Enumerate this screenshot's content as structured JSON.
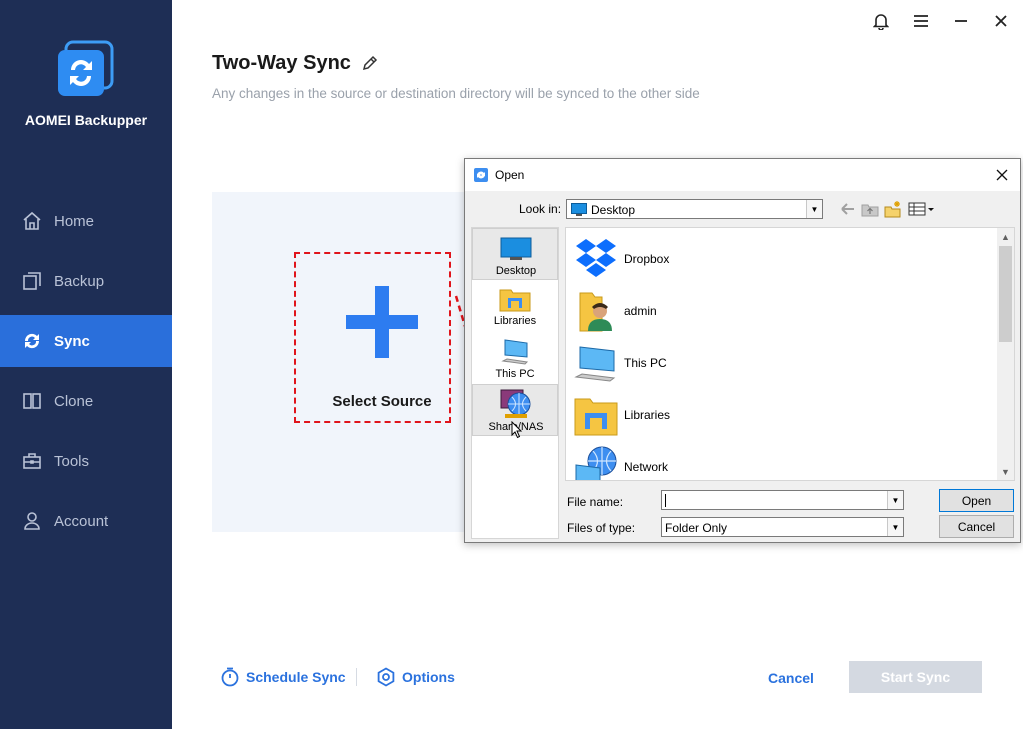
{
  "app": {
    "brand": "AOMEI Backupper",
    "accent": "#2a6fdb",
    "sidebar_bg": "#1e2e55"
  },
  "sidebar": {
    "items": [
      {
        "label": "Home",
        "icon": "home-icon"
      },
      {
        "label": "Backup",
        "icon": "backup-icon"
      },
      {
        "label": "Sync",
        "icon": "sync-icon",
        "active": true
      },
      {
        "label": "Clone",
        "icon": "clone-icon"
      },
      {
        "label": "Tools",
        "icon": "tools-icon"
      },
      {
        "label": "Account",
        "icon": "account-icon"
      }
    ]
  },
  "header": {
    "title": "Two-Way Sync",
    "subtitle": "Any changes in the source or destination directory will be synced to the other side"
  },
  "main": {
    "select_source_label": "Select Source"
  },
  "footer": {
    "schedule_label": "Schedule Sync",
    "options_label": "Options",
    "cancel_label": "Cancel",
    "start_label": "Start Sync"
  },
  "dialog": {
    "title": "Open",
    "look_in_label": "Look in:",
    "look_in_value": "Desktop",
    "places": [
      {
        "label": "Desktop",
        "icon": "desktop-icon"
      },
      {
        "label": "Libraries",
        "icon": "libraries-icon"
      },
      {
        "label": "This PC",
        "icon": "this-pc-icon"
      },
      {
        "label": "Share/NAS",
        "icon": "share-nas-icon"
      }
    ],
    "files": [
      {
        "label": "Dropbox",
        "icon": "dropbox-icon"
      },
      {
        "label": "admin",
        "icon": "user-folder-icon"
      },
      {
        "label": "This PC",
        "icon": "computer-icon"
      },
      {
        "label": "Libraries",
        "icon": "libraries-folder-icon"
      },
      {
        "label": "Network",
        "icon": "network-icon"
      }
    ],
    "file_name_label": "File name:",
    "file_name_value": "",
    "file_type_label": "Files of type:",
    "file_type_value": "Folder Only",
    "open_label": "Open",
    "cancel_label": "Cancel"
  }
}
